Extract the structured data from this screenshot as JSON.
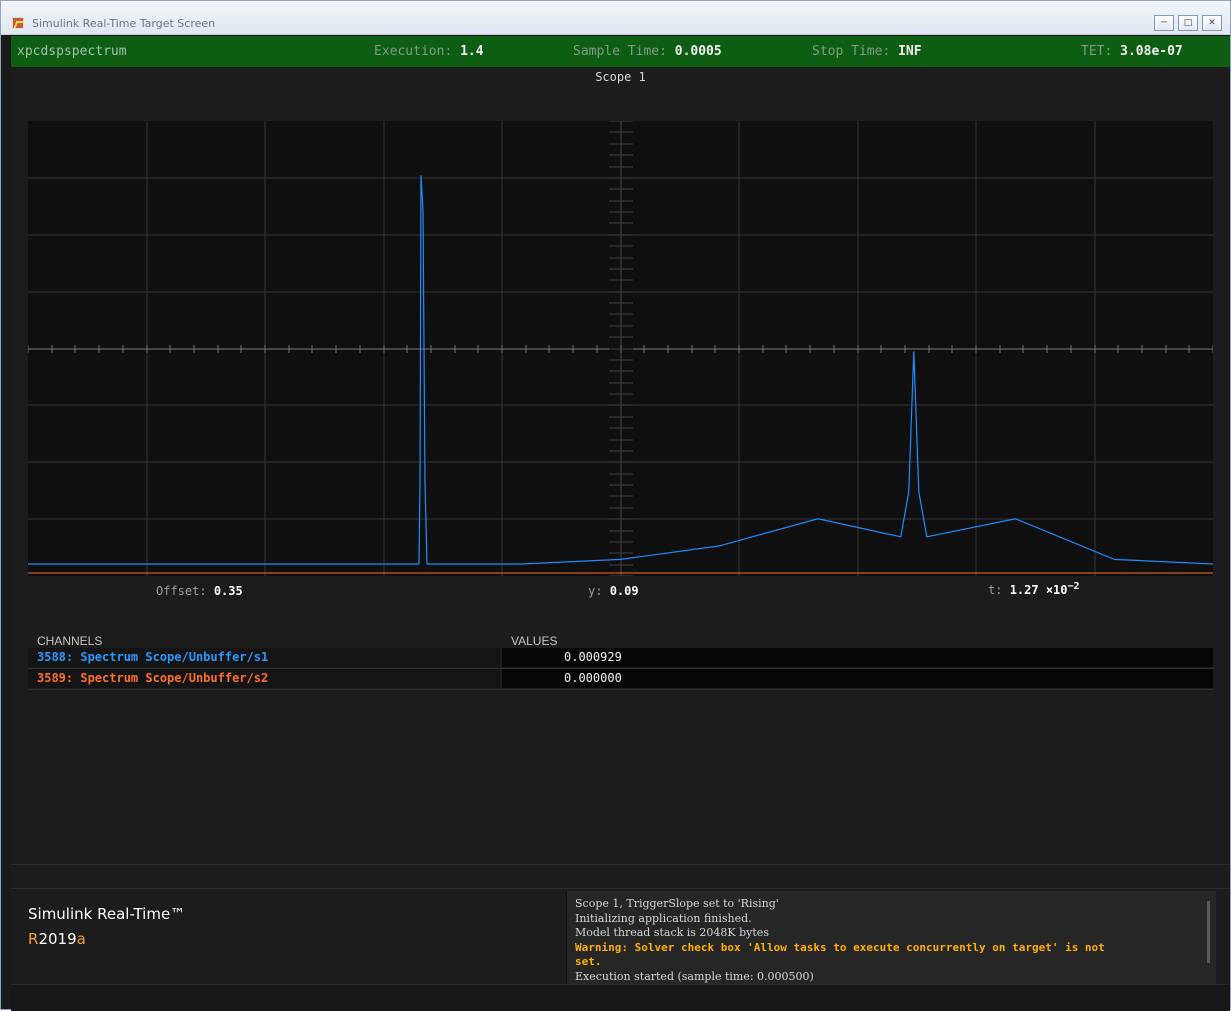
{
  "window": {
    "title": "Simulink Real-Time Target Screen",
    "minimize": "─",
    "maximize": "□",
    "close": "✕"
  },
  "status_bar": {
    "model": "xpcdspspectrum",
    "execution_label": "Execution:",
    "execution_value": "1.4",
    "sample_time_label": "Sample Time:",
    "sample_time_value": "0.0005",
    "stop_time_label": "Stop Time:",
    "stop_time_value": "INF",
    "tet_label": "TET:",
    "tet_value": "3.08e-07"
  },
  "scope": {
    "title": "Scope 1",
    "offset_label": "Offset:",
    "offset_value": "0.35",
    "y_label": "y:",
    "y_value": "0.09",
    "t_label": "t:",
    "t_mantissa": "1.27",
    "t_times": "×10",
    "t_exponent": "−2"
  },
  "channels": {
    "header_channels": "CHANNELS",
    "header_values": "VALUES",
    "rows": [
      {
        "name": "3588: Spectrum Scope/Unbuffer/s1",
        "value": "0.000929",
        "color": "#2798ff"
      },
      {
        "name": "3589: Spectrum Scope/Unbuffer/s2",
        "value": "0.000000",
        "color": "#ff6f24"
      }
    ]
  },
  "product": {
    "name": "Simulink Real-Time™",
    "release_r": "R",
    "release_year": "2019",
    "release_suffix": "a"
  },
  "log": [
    {
      "text": "Scope 1, TriggerSlope set to 'Rising'",
      "warning": false
    },
    {
      "text": "Initializing application finished.",
      "warning": false
    },
    {
      "text": "Model thread stack is 2048K bytes",
      "warning": false
    },
    {
      "text": "Warning: Solver check box 'Allow tasks to execute concurrently on target' is not",
      "warning": true
    },
    {
      "text": " set.",
      "warning": true
    },
    {
      "text": "Execution started (sample time: 0.000500)",
      "warning": false
    }
  ],
  "chart_data": {
    "type": "line",
    "title": "",
    "xlabel": "",
    "ylabel": "",
    "grid": true,
    "series": [
      {
        "name": "3588: Spectrum Scope/Unbuffer/s1",
        "color": "#1f8dff",
        "x": [
          0,
          1,
          2,
          3,
          4,
          5,
          6,
          7,
          8,
          9,
          10,
          11,
          12
        ],
        "y": [
          0.02,
          0.02,
          0.02,
          0.02,
          0.88,
          0.02,
          0.03,
          0.06,
          0.12,
          0.49,
          0.12,
          0.03,
          0.02
        ]
      },
      {
        "name": "3589: Spectrum Scope/Unbuffer/s2",
        "color": "#ff6f24",
        "x": [
          0,
          1,
          2,
          3,
          4,
          5,
          6,
          7,
          8,
          9,
          10,
          11,
          12
        ],
        "y": [
          0,
          0,
          0,
          0,
          0,
          0,
          0,
          0,
          0,
          0,
          0,
          0,
          0
        ]
      }
    ]
  }
}
